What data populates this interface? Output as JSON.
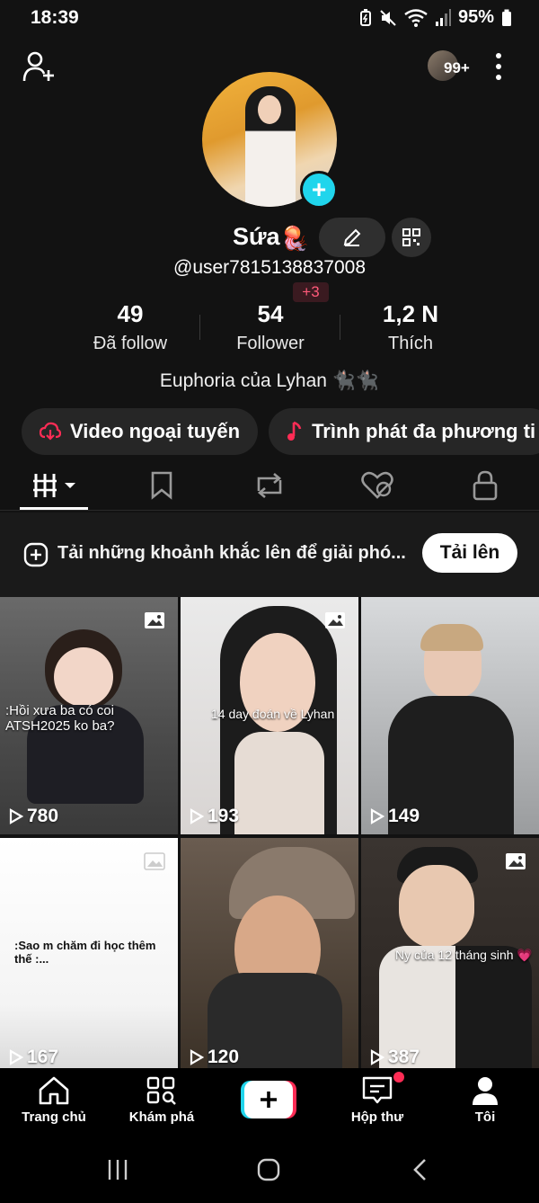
{
  "status": {
    "time": "18:39",
    "battery": "95%"
  },
  "top": {
    "badge": "99+"
  },
  "profile": {
    "name": "Sứa",
    "name_emoji": "🪼",
    "username": "@user7815138837008",
    "new_followers": "+3",
    "bio": "Euphoria của Lyhan 🐈‍⬛🐈‍⬛"
  },
  "stats": [
    {
      "num": "49",
      "label": "Đã follow"
    },
    {
      "num": "54",
      "label": "Follower"
    },
    {
      "num": "1,2 N",
      "label": "Thích"
    }
  ],
  "chips": [
    {
      "label": "Video ngoại tuyến",
      "icon": "cloud-download-icon"
    },
    {
      "label": "Trình phát đa phương ti",
      "icon": "music-note-icon"
    }
  ],
  "upload": {
    "text": "Tải những khoảnh khắc lên để giải phó...",
    "button": "Tải lên"
  },
  "videos": [
    {
      "views": "780",
      "caption": ":Hồi xưa ba có coi ATSH2025 ko ba?",
      "photo": true
    },
    {
      "views": "193",
      "caption": "14 day đoán về Lyhan",
      "photo": true
    },
    {
      "views": "149",
      "caption": "",
      "photo": false
    },
    {
      "views": "167",
      "caption": ":Sao m chăm đi học thêm thế :...",
      "photo": true
    },
    {
      "views": "120",
      "caption": "",
      "photo": false
    },
    {
      "views": "387",
      "caption": "Ny của 12 tháng sinh 💗",
      "photo": true
    }
  ],
  "nav": [
    {
      "label": "Trang chủ",
      "icon": "home-icon"
    },
    {
      "label": "Khám phá",
      "icon": "discover-icon"
    },
    {
      "label": "Hộp thư",
      "icon": "inbox-icon"
    },
    {
      "label": "Tôi",
      "icon": "profile-icon"
    }
  ],
  "colors": {
    "accent": "#20d5ec",
    "brand_red": "#fe2c55",
    "background": "#121212"
  }
}
